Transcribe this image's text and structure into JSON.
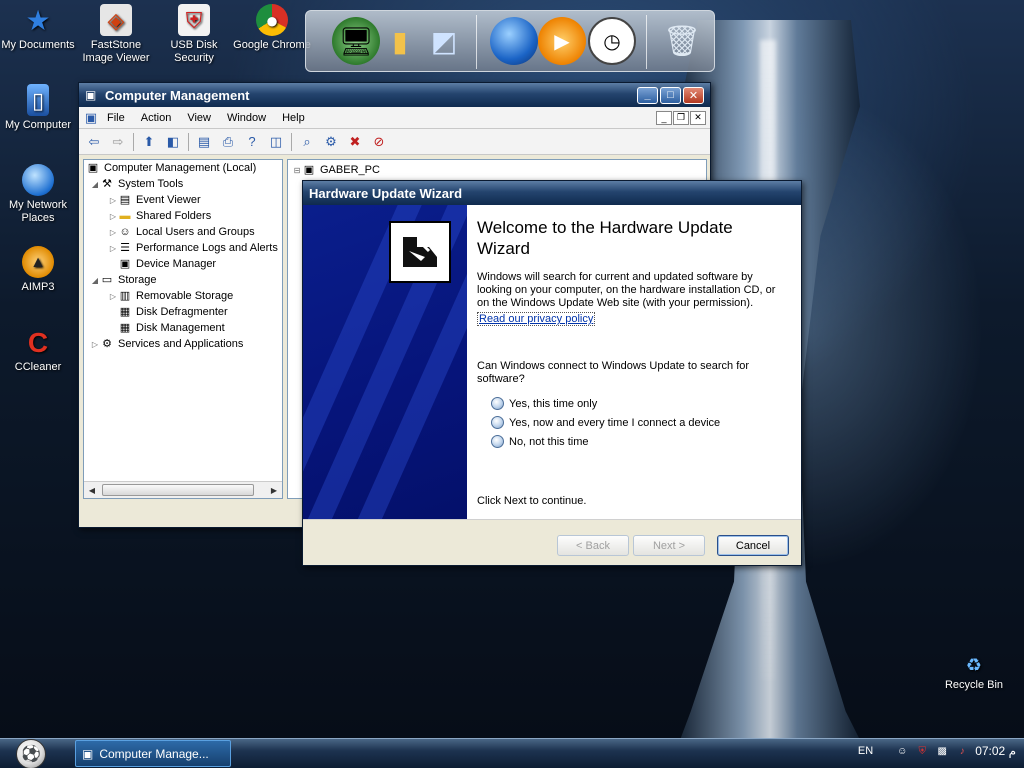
{
  "desktop_icons": [
    {
      "label": "My Documents",
      "icon": "star-icon"
    },
    {
      "label": "FastStone Image Viewer",
      "icon": "faststone-icon"
    },
    {
      "label": "USB Disk Security",
      "icon": "usb-shield-icon"
    },
    {
      "label": "Google Chrome",
      "icon": "chrome-icon"
    },
    {
      "label": "My Computer",
      "icon": "computer-icon"
    },
    {
      "label": "My Network Places",
      "icon": "network-globe-icon"
    },
    {
      "label": "AIMP3",
      "icon": "aimp-icon"
    },
    {
      "label": "CCleaner",
      "icon": "ccleaner-icon"
    },
    {
      "label": "Recycle Bin",
      "icon": "recycle-bin-icon"
    }
  ],
  "dock": {
    "items": [
      "network-icon",
      "computer-icon",
      "folder-icon",
      "control-panel-icon",
      "globe-icon",
      "media-player-icon",
      "clock-icon",
      "trash-icon"
    ]
  },
  "computer_management": {
    "title": "Computer Management",
    "menu": [
      "File",
      "Action",
      "View",
      "Window",
      "Help"
    ],
    "tree": [
      {
        "label": "Computer Management (Local)",
        "level": 0,
        "icon": "computer-icon"
      },
      {
        "label": "System Tools",
        "level": 1,
        "icon": "tools-icon"
      },
      {
        "label": "Event Viewer",
        "level": 2,
        "icon": "event-viewer-icon"
      },
      {
        "label": "Shared Folders",
        "level": 2,
        "icon": "shared-folder-icon"
      },
      {
        "label": "Local Users and Groups",
        "level": 2,
        "icon": "users-icon"
      },
      {
        "label": "Performance Logs and Alerts",
        "level": 2,
        "icon": "performance-icon"
      },
      {
        "label": "Device Manager",
        "level": 2,
        "icon": "device-manager-icon"
      },
      {
        "label": "Storage",
        "level": 1,
        "icon": "storage-icon"
      },
      {
        "label": "Removable Storage",
        "level": 2,
        "icon": "removable-storage-icon"
      },
      {
        "label": "Disk Defragmenter",
        "level": 2,
        "icon": "defrag-icon"
      },
      {
        "label": "Disk Management",
        "level": 2,
        "icon": "disk-management-icon"
      },
      {
        "label": "Services and Applications",
        "level": 1,
        "icon": "services-icon"
      }
    ],
    "right_pane_root": "GABER_PC"
  },
  "wizard": {
    "title": "Hardware Update Wizard",
    "heading": "Welcome to the Hardware Update Wizard",
    "intro": "Windows will search for current and updated software by looking on your computer, on the hardware installation CD, or on the Windows Update Web site (with your permission).",
    "privacy_link": "Read our privacy policy",
    "question": "Can Windows connect to Windows Update to search for software?",
    "options": [
      "Yes, this time only",
      "Yes, now and every time I connect a device",
      "No, not this time"
    ],
    "continue_text": "Click Next to continue.",
    "back_label": "< Back",
    "next_label": "Next >",
    "cancel_label": "Cancel"
  },
  "taskbar": {
    "task_label": "Computer Manage...",
    "language": "EN",
    "clock": "07:02 م"
  }
}
